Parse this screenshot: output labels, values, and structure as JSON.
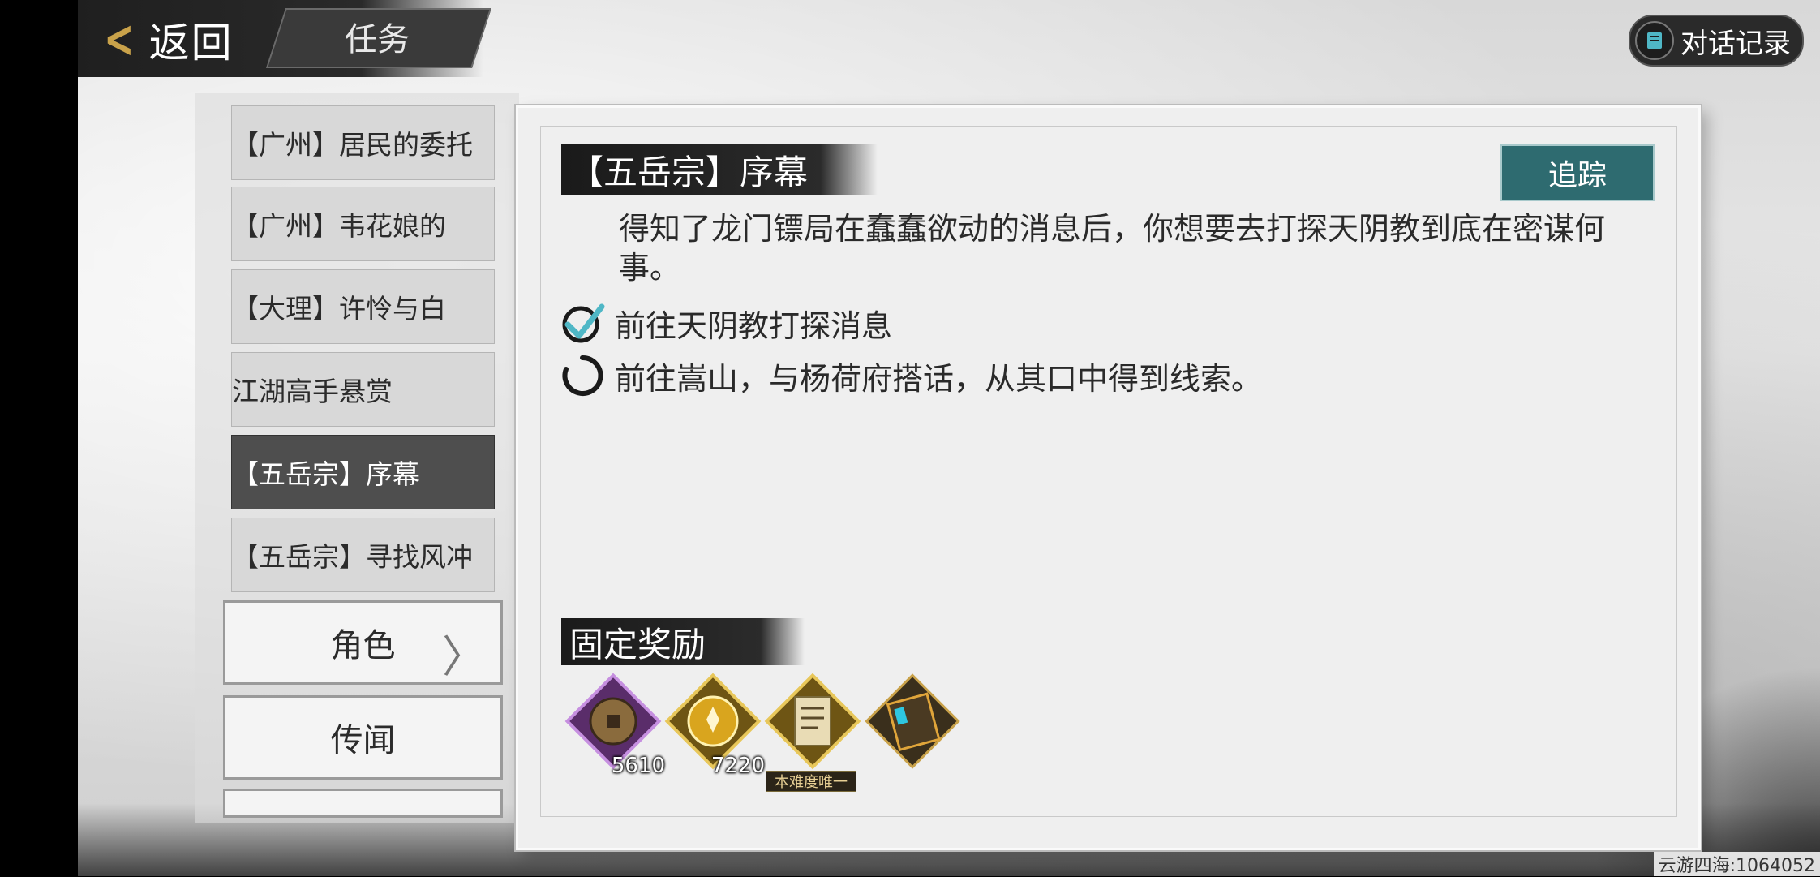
{
  "header": {
    "back_label": "返回",
    "tab_label": "任务",
    "dialog_log_label": "对话记录"
  },
  "quest_list": [
    {
      "label": "【广州】居民的委托"
    },
    {
      "label": "【广州】韦花娘的"
    },
    {
      "label": "【大理】许怜与白"
    },
    {
      "label": "江湖高手悬赏"
    },
    {
      "label": "【五岳宗】序幕",
      "active": true
    },
    {
      "label": "【五岳宗】寻找风冲"
    }
  ],
  "side_buttons": {
    "role_label": "角色",
    "rumor_label": "传闻"
  },
  "detail": {
    "title": "【五岳宗】序幕",
    "track_label": "追踪",
    "description": "得知了龙门镖局在蠢蠢欲动的消息后，你想要去打探天阴教到底在密谋何事。",
    "objectives": [
      {
        "text": "前往天阴教打探消息",
        "status": "done"
      },
      {
        "text": "前往嵩山，与杨荷府搭话，从其口中得到线索。",
        "status": "in-progress"
      }
    ],
    "rewards_title": "固定奖励",
    "rewards": [
      {
        "icon": "copper-coin-icon",
        "count": "5610",
        "frame_color": "#7b3f8f"
      },
      {
        "icon": "experience-orb-icon",
        "count": "7220",
        "frame_color": "#b8911f"
      },
      {
        "icon": "scroll-item-icon",
        "count": "",
        "tag": "本难度唯一",
        "frame_color": "#b8911f"
      },
      {
        "icon": "book-item-icon",
        "count": "",
        "frame_color": "#8a6a2a"
      }
    ]
  },
  "watermark": "云游四海:1064052",
  "colors": {
    "accent_teal": "#2e6b70",
    "active_item": "#4e4e4e",
    "gold": "#c9a24a"
  }
}
